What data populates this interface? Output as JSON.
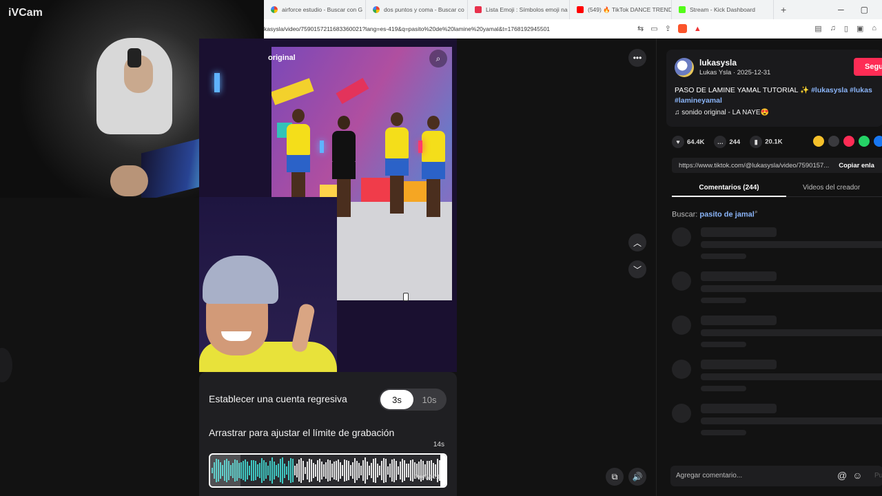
{
  "webcam": {
    "label": "iVCam"
  },
  "browser": {
    "tabs": [
      {
        "label": "airforce estudio - Buscar con G",
        "icon": "google-icon"
      },
      {
        "label": "dos puntos y coma - Buscar co",
        "icon": "google-icon"
      },
      {
        "label": "Lista Emoji : Símbolos emoji na",
        "icon": "emoji-list-icon"
      },
      {
        "label": "(549) 🔥 TikTok DANCE TREND",
        "icon": "youtube-icon"
      },
      {
        "label": "Stream - Kick Dashboard",
        "icon": "kick-icon"
      }
    ],
    "new_tab": "+",
    "url": "kasysla/video/7590157211683360021?lang=es-419&q=pasito%20de%20lamine%20yamal&t=1768192945501"
  },
  "video": {
    "search_label": "original"
  },
  "record": {
    "countdown_label": "Establecer una cuenta regresiva",
    "countdown_options": [
      "3s",
      "10s"
    ],
    "limit_label": "Arrastrar para ajustar el límite de grabación",
    "max_label": "14s",
    "time_label": "00:00/00:14"
  },
  "side": {
    "username": "lukasysla",
    "meta": "Lukas Ysla · 2025-12-31",
    "follow_label": "Segu",
    "description": "PASO DE LAMINE YAMAL TUTORIAL ✨",
    "hashtags": [
      "#lukasysla",
      "#lukas",
      "#lamineyamal"
    ],
    "music": "sonido original - LA NAYE😍",
    "stats": {
      "likes": "64.4K",
      "comments": "244",
      "saves": "20.1K"
    },
    "link": "https://www.tiktok.com/@lukasysla/video/7590157...",
    "copy_label": "Copiar enla",
    "tab_comments": "Comentarios (244)",
    "tab_videos": "Videos del creador",
    "search_prefix": "Buscar:",
    "search_term": "pasito de jamal",
    "comment_placeholder": "Agregar comentario...",
    "post_label": "Pu"
  },
  "colors": {
    "accent": "#fe2c55",
    "link": "#8ab4f8",
    "panel_bg": "#1f1f22"
  }
}
